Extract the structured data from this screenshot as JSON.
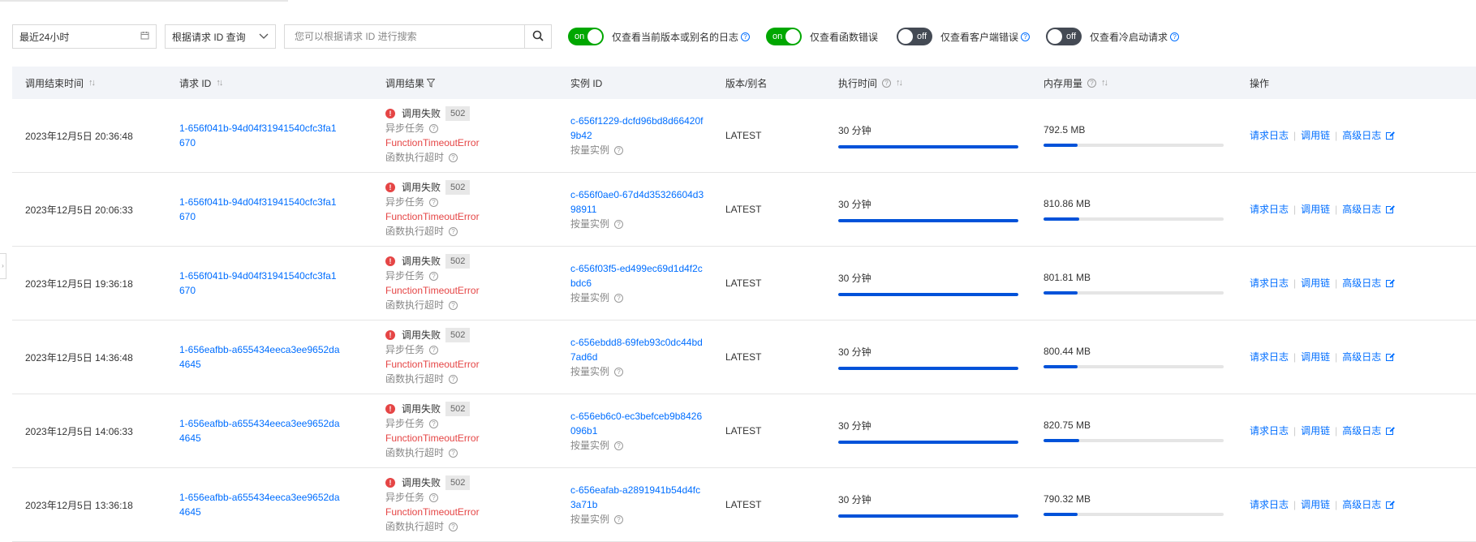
{
  "toolbar": {
    "time_range": "最近24小时",
    "query_mode": "根据请求 ID 查询",
    "search_placeholder": "您可以根据请求 ID 进行搜索",
    "filters": [
      {
        "label": "仅查看当前版本或别名的日志",
        "state": "on",
        "toggle_text": "on"
      },
      {
        "label": "仅查看函数错误",
        "state": "on",
        "toggle_text": "on"
      },
      {
        "label": "仅查看客户端错误",
        "state": "off",
        "toggle_text": "off"
      },
      {
        "label": "仅查看冷启动请求",
        "state": "off",
        "toggle_text": "off"
      }
    ]
  },
  "table": {
    "headers": {
      "end_time": "调用结束时间",
      "request_id": "请求 ID",
      "result": "调用结果",
      "instance_id": "实例 ID",
      "version": "版本/别名",
      "duration": "执行时间",
      "memory": "内存用量",
      "actions": "操作"
    },
    "action_labels": {
      "request_log": "请求日志",
      "trace": "调用链",
      "advanced_log": "高级日志"
    },
    "rows": [
      {
        "time": "2023年12月5日 20:36:48",
        "request_id": "1-656f041b-94d04f31941540cfc3fa1670",
        "status": "调用失败",
        "code": "502",
        "type": "异步任务",
        "error": "FunctionTimeoutError",
        "error_desc": "函数执行超时",
        "instance_id": "c-656f1229-dcfd96bd8d66420f9b42",
        "instance_type": "按量实例",
        "version": "LATEST",
        "duration": "30 分钟",
        "duration_pct": 100,
        "memory": "792.5 MB",
        "memory_pct": 19
      },
      {
        "time": "2023年12月5日 20:06:33",
        "request_id": "1-656f041b-94d04f31941540cfc3fa1670",
        "status": "调用失败",
        "code": "502",
        "type": "异步任务",
        "error": "FunctionTimeoutError",
        "error_desc": "函数执行超时",
        "instance_id": "c-656f0ae0-67d4d35326604d398911",
        "instance_type": "按量实例",
        "version": "LATEST",
        "duration": "30 分钟",
        "duration_pct": 100,
        "memory": "810.86 MB",
        "memory_pct": 20
      },
      {
        "time": "2023年12月5日 19:36:18",
        "request_id": "1-656f041b-94d04f31941540cfc3fa1670",
        "status": "调用失败",
        "code": "502",
        "type": "异步任务",
        "error": "FunctionTimeoutError",
        "error_desc": "函数执行超时",
        "instance_id": "c-656f03f5-ed499ec69d1d4f2cbdc6",
        "instance_type": "按量实例",
        "version": "LATEST",
        "duration": "30 分钟",
        "duration_pct": 100,
        "memory": "801.81 MB",
        "memory_pct": 19
      },
      {
        "time": "2023年12月5日 14:36:48",
        "request_id": "1-656eafbb-a655434eeca3ee9652da4645",
        "status": "调用失败",
        "code": "502",
        "type": "异步任务",
        "error": "FunctionTimeoutError",
        "error_desc": "函数执行超时",
        "instance_id": "c-656ebdd8-69feb93c0dc44bd7ad6d",
        "instance_type": "按量实例",
        "version": "LATEST",
        "duration": "30 分钟",
        "duration_pct": 100,
        "memory": "800.44 MB",
        "memory_pct": 19
      },
      {
        "time": "2023年12月5日 14:06:33",
        "request_id": "1-656eafbb-a655434eeca3ee9652da4645",
        "status": "调用失败",
        "code": "502",
        "type": "异步任务",
        "error": "FunctionTimeoutError",
        "error_desc": "函数执行超时",
        "instance_id": "c-656eb6c0-ec3befceb9b8426096b1",
        "instance_type": "按量实例",
        "version": "LATEST",
        "duration": "30 分钟",
        "duration_pct": 100,
        "memory": "820.75 MB",
        "memory_pct": 20
      },
      {
        "time": "2023年12月5日 13:36:18",
        "request_id": "1-656eafbb-a655434eeca3ee9652da4645",
        "status": "调用失败",
        "code": "502",
        "type": "异步任务",
        "error": "FunctionTimeoutError",
        "error_desc": "函数执行超时",
        "instance_id": "c-656eafab-a2891941b54d4fc3a71b",
        "instance_type": "按量实例",
        "version": "LATEST",
        "duration": "30 分钟",
        "duration_pct": 100,
        "memory": "790.32 MB",
        "memory_pct": 19
      }
    ]
  },
  "colors": {
    "accent": "#006eff",
    "toggle_on": "#00a700",
    "toggle_off": "#444a54",
    "error": "#e54545",
    "progress": "#0052d9"
  },
  "icons": {
    "calendar": "calendar-icon",
    "dropdown": "chevron-down-icon",
    "search": "search-icon",
    "help": "help-circle-icon",
    "filter": "filter-icon",
    "sort": "sort-icon",
    "error": "error-circle-icon",
    "external": "external-link-icon"
  }
}
